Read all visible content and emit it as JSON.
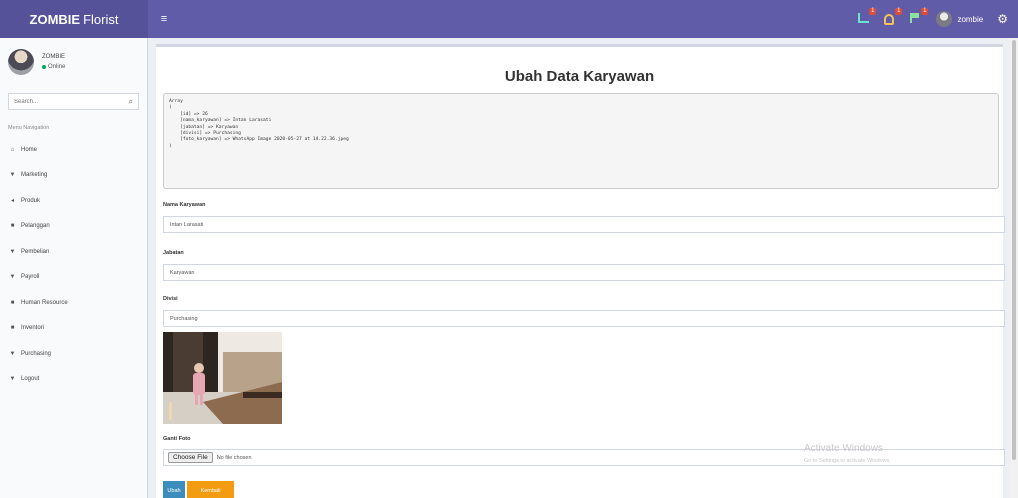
{
  "app": {
    "logo_bold": "ZOMBIE",
    "logo_rest": "Florist"
  },
  "navbar": {
    "toggle_label": "≡",
    "notifications": [
      {
        "icon": "bell-icon",
        "count": "1"
      },
      {
        "icon": "flag-icon",
        "count": "1"
      },
      {
        "icon": "tasks-icon",
        "count": "1"
      }
    ],
    "user_name": "zombie",
    "settings_icon": "gears-icon"
  },
  "sidebar": {
    "user": {
      "name": "ZOMBIE",
      "status": "Online"
    },
    "search": {
      "placeholder": "Search..."
    },
    "menu_header": "Menu Navigation",
    "items": [
      {
        "label": "Home",
        "icon": "home-icon",
        "glyph": "⌂"
      },
      {
        "label": "Marketing",
        "icon": "tag-icon",
        "glyph": "▼"
      },
      {
        "label": "Produk",
        "icon": "product-icon",
        "glyph": "◂"
      },
      {
        "label": "Pelanggan",
        "icon": "users-icon",
        "glyph": "■"
      },
      {
        "label": "Pembelian",
        "icon": "cart-icon",
        "glyph": "▼"
      },
      {
        "label": "Payroll",
        "icon": "payroll-icon",
        "glyph": "▼"
      },
      {
        "label": "Human Resource",
        "icon": "hr-icon",
        "glyph": "■"
      },
      {
        "label": "Inventori",
        "icon": "inventory-icon",
        "glyph": "■"
      },
      {
        "label": "Purchasing",
        "icon": "purchasing-icon",
        "glyph": "▼"
      },
      {
        "label": "Logout",
        "icon": "logout-icon",
        "glyph": "▼"
      }
    ]
  },
  "main": {
    "page_title": "Ubah Data Karyawan",
    "debug_output": "Array\n(\n    [id] => 26\n    [nama_karyawan] => Intan Larasati\n    [jabatan] => Karyawan\n    [divisi] => Purchasing\n    [foto_karyawan] => WhatsApp Image 2020-05-27 at 14.22.36.jpeg\n)",
    "fields": {
      "nama": {
        "label": "Nama Karyawan",
        "value": "Intan Larasati"
      },
      "jabatan": {
        "label": "Jabatan",
        "value": "Karyawan"
      },
      "divisi": {
        "label": "Divisi",
        "value": "Purchasing"
      }
    },
    "photo": {
      "label": "Ganti Foto",
      "choose_button": "Choose File",
      "file_status": "No file chosen"
    },
    "buttons": {
      "submit": "Ubah",
      "cancel": "Kembali"
    }
  },
  "watermark": {
    "title": "Activate Windows",
    "subtitle": "Go to Settings to activate Windows."
  },
  "colors": {
    "navbar": "#605ca8",
    "logo_bg": "#555299",
    "primary": "#3c8dbc",
    "warning": "#f39c12",
    "online": "#00a65a"
  }
}
